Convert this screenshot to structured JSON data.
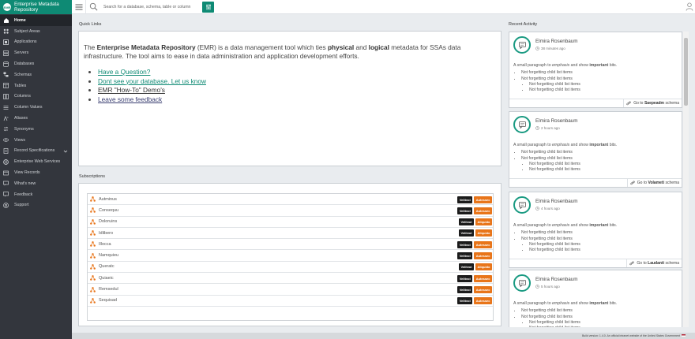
{
  "brand": {
    "logo_text": "EMR",
    "title": "Enterprise Metadata Repository"
  },
  "sidebar": {
    "items": [
      {
        "label": "Home",
        "icon": "home-icon"
      },
      {
        "label": "Subject Areas",
        "icon": "subject-areas-icon"
      },
      {
        "label": "Applications",
        "icon": "applications-icon"
      },
      {
        "label": "Servers",
        "icon": "servers-icon"
      },
      {
        "label": "Databases",
        "icon": "databases-icon"
      },
      {
        "label": "Schemas",
        "icon": "schemas-icon"
      },
      {
        "label": "Tables",
        "icon": "tables-icon"
      },
      {
        "label": "Columns",
        "icon": "columns-icon"
      },
      {
        "label": "Column Values",
        "icon": "column-values-icon"
      },
      {
        "label": "Aliases",
        "icon": "aliases-icon"
      },
      {
        "label": "Synonyms",
        "icon": "synonyms-icon"
      },
      {
        "label": "Views",
        "icon": "views-icon"
      },
      {
        "label": "Record Specifications",
        "icon": "record-specifications-icon"
      },
      {
        "label": "Enterprise Web Services",
        "icon": "web-services-icon"
      },
      {
        "label": "View Records",
        "icon": "view-records-icon"
      },
      {
        "label": "What's new",
        "icon": "whats-new-icon"
      },
      {
        "label": "Feedback",
        "icon": "feedback-icon"
      },
      {
        "label": "Support",
        "icon": "support-icon"
      }
    ]
  },
  "topbar": {
    "search_placeholder": "Search for a database, schema, table or column"
  },
  "quick_links": {
    "title": "Quick Links",
    "intro": {
      "p1": "The ",
      "b1": "Enterprise Metadata Repository",
      "p2": " (EMR) is a data management tool which ties ",
      "b2": "physical",
      "p3": " and ",
      "b3": "logical",
      "p4": " metadata for SSAs data infrastructure. The tool aims to ease in data administration and application development efforts."
    },
    "links": [
      "Have a Question?",
      "Dont see your database. Let us know",
      "EMR \"How-To\" Demo's",
      "Leave some feedback"
    ]
  },
  "subscriptions": {
    "title": "Subscriptions",
    "dark_label": "Velitvol",
    "orange_label": "Aliquido",
    "rows": [
      {
        "name": "Autminus",
        "dark": "Velitvol",
        "orange": "Autessec"
      },
      {
        "name": "Consequu",
        "dark": "Velitvol",
        "orange": "Autessec"
      },
      {
        "name": "Doloruins",
        "dark": "Velitvol",
        "orange": "Aliquido"
      },
      {
        "name": "Idlibero",
        "dark": "Velitvol",
        "orange": "Aliquido"
      },
      {
        "name": "Illocca",
        "dark": "Velitvol",
        "orange": "Autessec"
      },
      {
        "name": "Namquieu",
        "dark": "Velitvol",
        "orange": "Autessec"
      },
      {
        "name": "Queratc",
        "dark": "Velitvol",
        "orange": "Aliquido"
      },
      {
        "name": "Quiaeic",
        "dark": "Velitvol",
        "orange": "Autessec"
      },
      {
        "name": "Remsedul",
        "dark": "Velitvol",
        "orange": "Autessec"
      },
      {
        "name": "Sequisad",
        "dark": "Velitvol",
        "orange": "Autessec"
      }
    ]
  },
  "activity": {
    "title": "Recent Activity",
    "cards": [
      {
        "name": "Elmira Rosenbaum",
        "time": "38 minutes ago",
        "goto_prefix": "Go to",
        "goto_target": "Saepeadm",
        "goto_suffix": "schema"
      },
      {
        "name": "Elmira Rosenbaum",
        "time": "2 hours ago",
        "goto_prefix": "Go to",
        "goto_target": "Volameti",
        "goto_suffix": "schema"
      },
      {
        "name": "Elmira Rosenbaum",
        "time": "4 hours ago",
        "goto_prefix": "Go to",
        "goto_target": "Laudanti",
        "goto_suffix": "schema"
      },
      {
        "name": "Elmira Rosenbaum",
        "time": "5 hours ago",
        "goto_prefix": "Go to",
        "goto_target": "",
        "goto_suffix": ""
      }
    ],
    "body": {
      "p1": "A small paragraph to ",
      "em": "emphasis",
      "p2": " and show ",
      "strong": "important",
      "p3": " bits.",
      "item1": "Not forgetting child list items",
      "item2": "Not forgetting child list items",
      "sub1": "Not forgetting child list items",
      "sub2": "Not forgetting child list items"
    }
  },
  "footer": {
    "text": "Build version: 1.4.0. An official intranet website of the United States Government"
  },
  "colors": {
    "brand": "#0e8a74",
    "sidebar": "#33363d",
    "badge_dark": "#1b1b1b",
    "badge_orange": "#e8751a"
  }
}
